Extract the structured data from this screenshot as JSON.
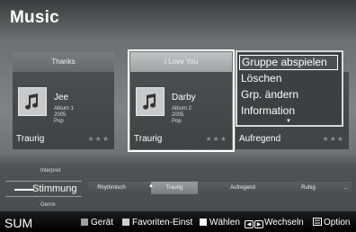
{
  "title": "Music",
  "cards": [
    {
      "header": "Thanks",
      "artist": "Jee",
      "album": "Album 1",
      "year": "2005",
      "genre": "Pop",
      "mood": "Traurig",
      "stars": "★★★"
    },
    {
      "header": "I Love You",
      "artist": "Darby",
      "album": "Album 2",
      "year": "2005",
      "genre": "Pop",
      "mood": "Traurig",
      "stars": "★★★"
    },
    {
      "mood": "Aufregend",
      "stars": "★★★"
    }
  ],
  "context_menu": {
    "items": [
      "Gruppe abspielen",
      "Löschen",
      "Grp. ändern",
      "Information"
    ],
    "highlighted": 0,
    "more_arrow": "▼"
  },
  "filter": {
    "up_label": "Interpret",
    "current": "Stimmung",
    "down_label": "Genre",
    "options": [
      "Rhythmisch",
      "Traurig",
      "Aufregend",
      "Ruhig",
      "..."
    ],
    "selected": 1,
    "selected_arrow": "▲"
  },
  "footer": {
    "sum": "SUM",
    "items": [
      {
        "label": "Gerät",
        "color": "#9e9e9e"
      },
      {
        "label": "Favoriten-Einst",
        "color": "#d0d0d0"
      },
      {
        "label": "Wählen",
        "color": "#ffffff"
      }
    ],
    "wechseln": "Wechseln",
    "option": "Option"
  },
  "colors": {
    "accent": "#ffffff",
    "background": "#6d6f71"
  }
}
